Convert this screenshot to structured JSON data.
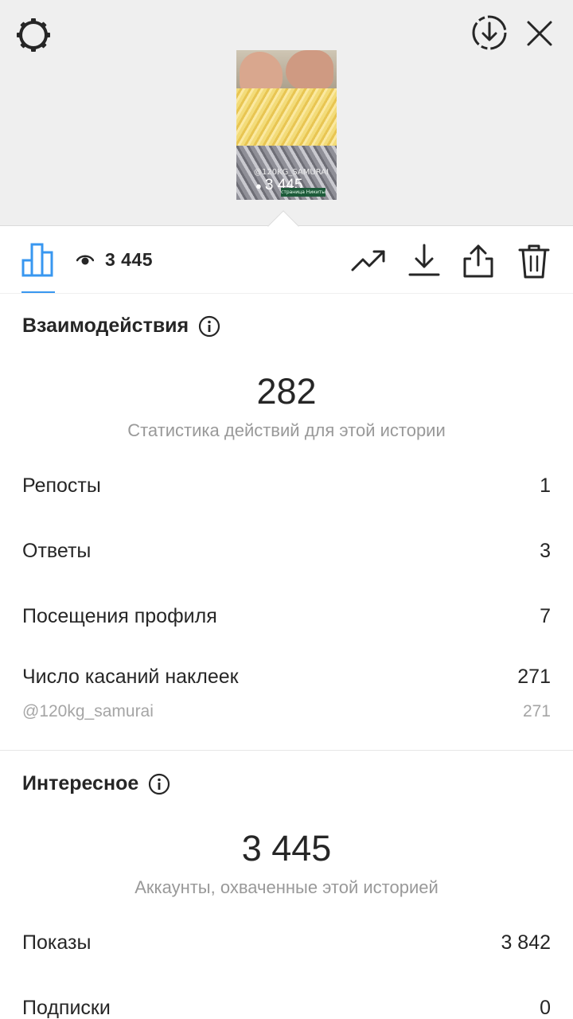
{
  "story": {
    "sticker_text": "@120KG_SAMURAI",
    "views": "3 445",
    "tag_text": "страница Никиты"
  },
  "toolbar": {
    "view_count": "3 445",
    "active_color": "#3897f0"
  },
  "interactions": {
    "title": "Взаимодействия",
    "total": "282",
    "subtitle": "Статистика действий для этой истории",
    "rows": [
      {
        "label": "Репосты",
        "value": "1"
      },
      {
        "label": "Ответы",
        "value": "3"
      },
      {
        "label": "Посещения профиля",
        "value": "7"
      },
      {
        "label": "Число касаний наклеек",
        "value": "271"
      }
    ],
    "sticker_row": {
      "label": "@120kg_samurai",
      "value": "271"
    }
  },
  "discovery": {
    "title": "Интересное",
    "total": "3 445",
    "subtitle": "Аккаунты, охваченные этой историей",
    "rows": [
      {
        "label": "Показы",
        "value": "3 842"
      },
      {
        "label": "Подписки",
        "value": "0"
      }
    ]
  },
  "icons": {
    "settings": "gear-icon",
    "save": "download-circle-icon",
    "close": "close-icon",
    "stats": "bar-chart-icon",
    "eye": "eye-icon",
    "promote": "trending-up-icon",
    "download": "download-icon",
    "share": "share-icon",
    "delete": "trash-icon",
    "info": "info-icon"
  }
}
